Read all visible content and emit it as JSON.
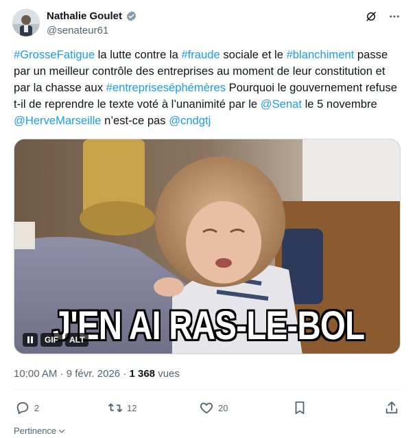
{
  "author": {
    "display_name": "Nathalie Goulet",
    "handle": "@senateur61",
    "verified_icon": "verified-badge-icon"
  },
  "tweet": {
    "segments": [
      {
        "text": "#GrosseFatigue",
        "link": true
      },
      {
        "text": " la lutte contre la ",
        "link": false
      },
      {
        "text": "#fraude",
        "link": true
      },
      {
        "text": " sociale et le ",
        "link": false
      },
      {
        "text": "#blanchiment",
        "link": true
      },
      {
        "text": " passe par un meilleur contrôle des entreprises au moment de leur constitution et par la chasse aux ",
        "link": false
      },
      {
        "text": "#entrepriseséphémères",
        "link": true
      },
      {
        "text": " Pourquoi le gouvernement refuse t-il de reprendre le texte voté à l’unanimité par le ",
        "link": false
      },
      {
        "text": "@Senat",
        "link": true
      },
      {
        "text": " le 5 novembre ",
        "link": false
      },
      {
        "text": "@HerveMarseille",
        "link": true
      },
      {
        "text": " n’est-ce pas ",
        "link": false
      },
      {
        "text": "@cndgtj",
        "link": true
      }
    ]
  },
  "media": {
    "caption": "J'EN AI RAS-LE-BOL",
    "gif_label": "GIF",
    "alt_label": "ALT"
  },
  "meta": {
    "time": "10:00 AM",
    "separator": " · ",
    "date": "9 févr. 2026",
    "views_count": "1 368",
    "views_label": " vues"
  },
  "actions": {
    "replies": "2",
    "reposts": "12",
    "likes": "20"
  },
  "footer": {
    "label": "Pertinence"
  },
  "colors": {
    "link": "#1d9bf0",
    "secondary_text": "#536471",
    "verified": "#829aab"
  }
}
